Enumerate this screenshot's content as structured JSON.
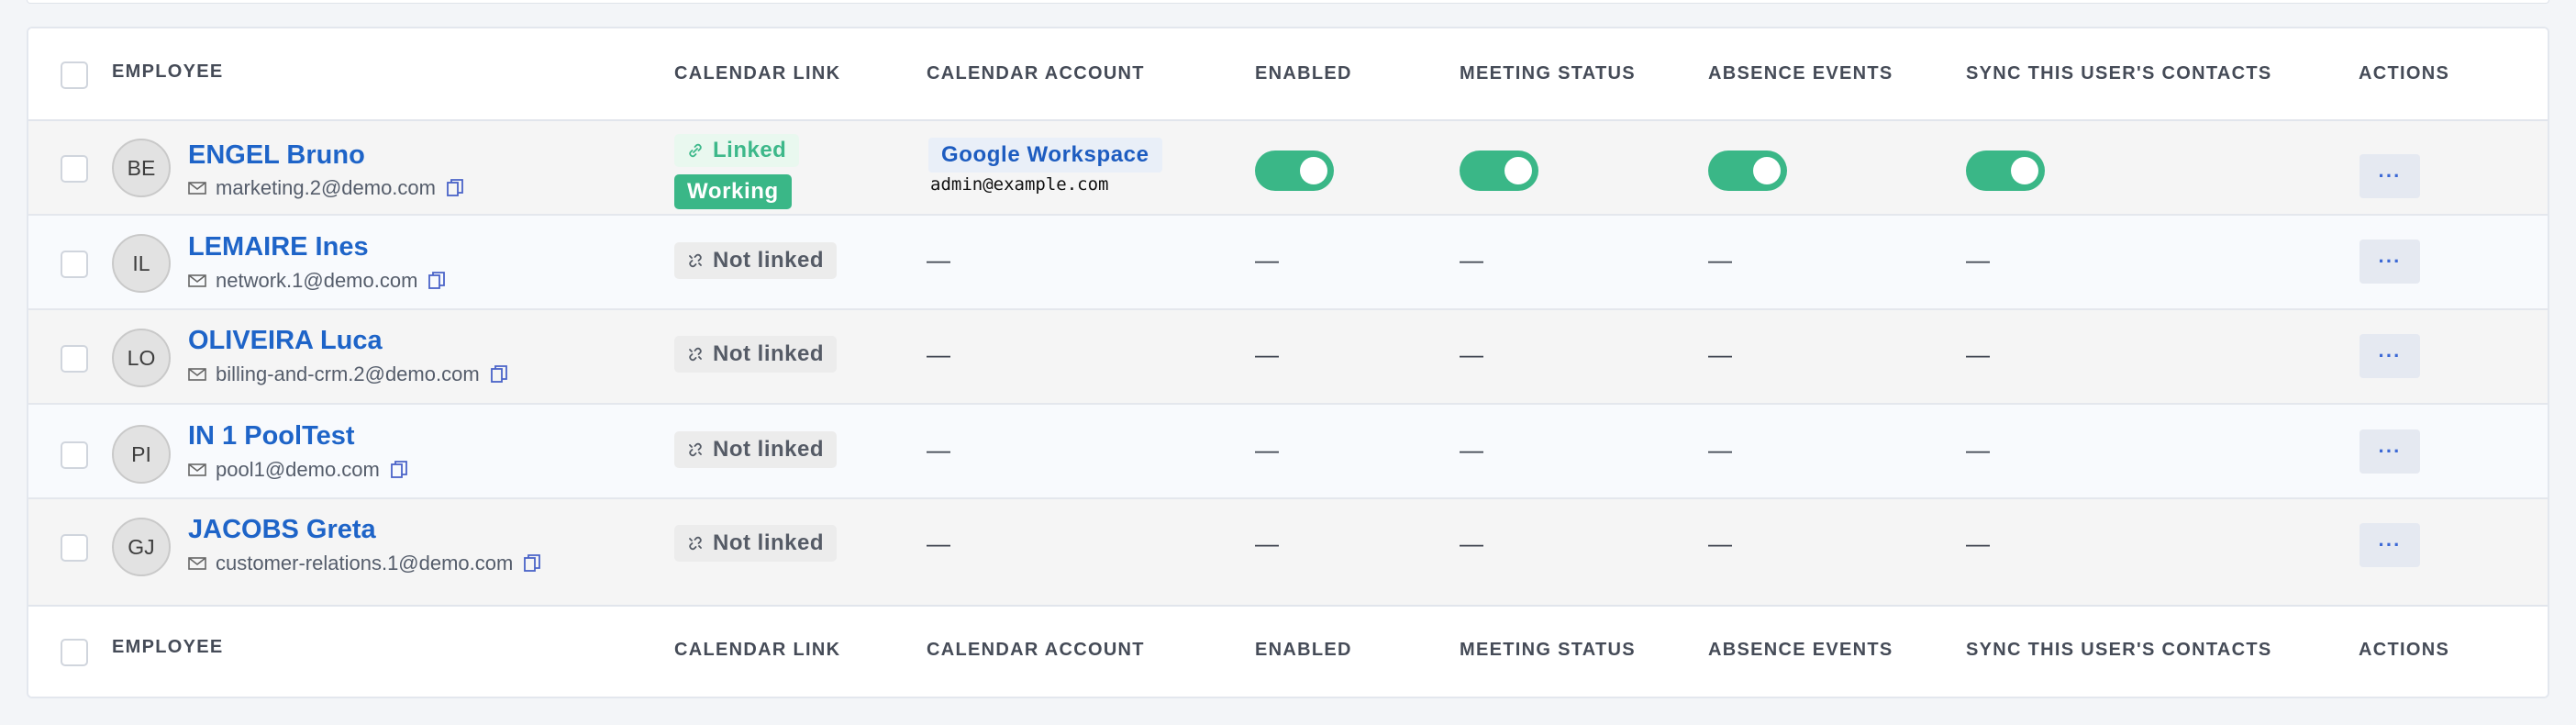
{
  "columns": {
    "employee": "EMPLOYEE",
    "calendar_link": "CALENDAR LINK",
    "calendar_account": "CALENDAR ACCOUNT",
    "enabled": "ENABLED",
    "meeting_status": "MEETING STATUS",
    "absence_events": "ABSENCE EVENTS",
    "sync_contacts": "SYNC THIS USER'S CONTACTS",
    "actions": "ACTIONS"
  },
  "dash": "—",
  "actions_label": "···",
  "rows": [
    {
      "initials": "BE",
      "name": "ENGEL Bruno",
      "email": "marketing.2@demo.com",
      "link_status": "Linked",
      "meeting_badge": "Working",
      "account_provider": "Google Workspace",
      "account_email": "admin@example.com",
      "enabled": true,
      "meeting_status": true,
      "absence_events": true,
      "sync_contacts": true
    },
    {
      "initials": "IL",
      "name": "LEMAIRE Ines",
      "email": "network.1@demo.com",
      "link_status": "Not linked"
    },
    {
      "initials": "LO",
      "name": "OLIVEIRA Luca",
      "email": "billing-and-crm.2@demo.com",
      "link_status": "Not linked"
    },
    {
      "initials": "PI",
      "name": "IN 1 PoolTest",
      "email": "pool1@demo.com",
      "link_status": "Not linked"
    },
    {
      "initials": "GJ",
      "name": "JACOBS Greta",
      "email": "customer-relations.1@demo.com",
      "link_status": "Not linked"
    }
  ],
  "colors": {
    "accent": "#3ab787",
    "name_link": "#1e64c8",
    "provider": "#1d5cc0"
  }
}
